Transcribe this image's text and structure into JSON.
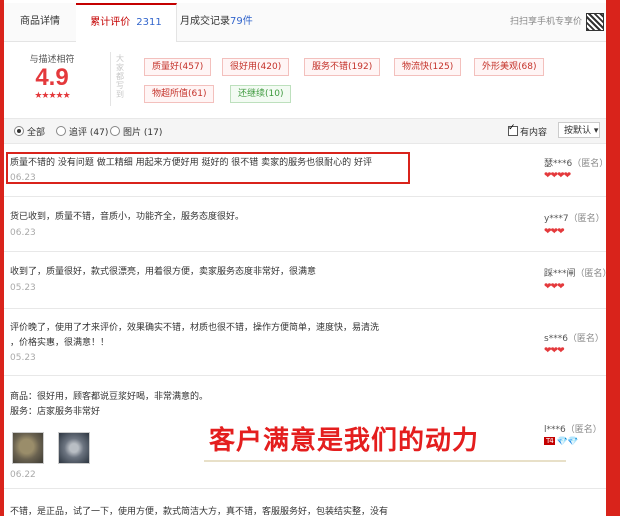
{
  "tabs": {
    "detail": "商品详情",
    "reviews_label": "累计评价",
    "reviews_count": "2311",
    "sales_label": "月成交记录",
    "sales_count": "79件"
  },
  "scan_text": "扫扫享手机专享价",
  "rating": {
    "label": "与描述相符",
    "score": "4.9",
    "stars": "★★★★★",
    "side_label": "大家都写到"
  },
  "tags": [
    {
      "label": "质量好(457)"
    },
    {
      "label": "很好用(420)"
    },
    {
      "label": "服务不错(192)"
    },
    {
      "label": "物流快(125)"
    },
    {
      "label": "外形美观(68)"
    },
    {
      "label": "物超所值(61)"
    },
    {
      "label": "还继续(10)"
    }
  ],
  "filter": {
    "all": "全部",
    "followup": "追评 (47)",
    "images": "图片 (17)",
    "has_content": "有内容",
    "sort": "按默认 ▾"
  },
  "reviews": [
    {
      "text": "质量不错的 没有问题 做工精细 用起来方便好用 挺好的 很不错 卖家的服务也很耐心的 好评",
      "date": "06.23",
      "user": "瑟***6",
      "anon": "（匿名）",
      "hearts": "❤❤❤❤"
    },
    {
      "text": "货已收到，质量不错，音质小，功能齐全，服务态度很好。",
      "date": "06.23",
      "user": "y***7",
      "anon": "（匿名）",
      "hearts": "❤❤❤"
    },
    {
      "text": "收到了，质量很好，款式很漂亮，用着很方便，卖家服务态度非常好，很满意",
      "date": "05.23",
      "user": "踩***闸",
      "anon": "（匿名）",
      "hearts": "❤❤❤"
    },
    {
      "text_line1": "评价晚了，使用了才来评价，效果确实不错，材质也很不错，操作方便简单，速度快，易清洗",
      "text_line2": "，价格实惠，很满意！！",
      "date": "05.23",
      "user": "s***6",
      "anon": "（匿名）",
      "hearts": "❤❤❤"
    },
    {
      "text_line1": "商品：很好用，顾客都说豆浆好喝，非常满意的。",
      "text_line2": "服务：店家服务非常好",
      "date": "06.22",
      "user": "l***6",
      "anon": "（匿名）",
      "badge": "T4",
      "hearts": "💎💎"
    },
    {
      "text": "不错，是正品，试了一下，使用方便，款式简洁大方，真不错，客服服务好，包装结实整，没有"
    }
  ],
  "banner": "客户满意是我们的动力"
}
